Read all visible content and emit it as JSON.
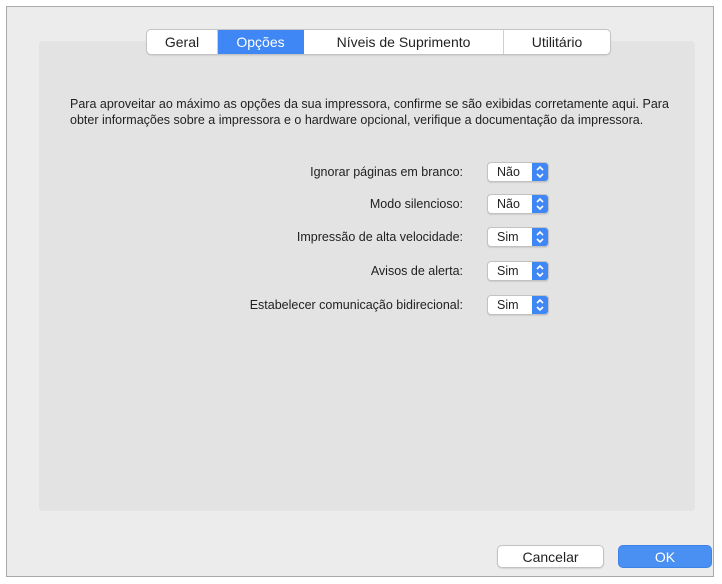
{
  "tabs": [
    {
      "label": "Geral",
      "selected": false
    },
    {
      "label": "Opções",
      "selected": true
    },
    {
      "label": "Níveis de Suprimento",
      "selected": false
    },
    {
      "label": "Utilitário",
      "selected": false
    }
  ],
  "description": "Para aproveitar ao máximo as opções da sua impressora, confirme se são exibidas corretamente aqui. Para obter informações sobre a impressora e o hardware opcional, verifique a documentação da impressora.",
  "options": [
    {
      "label": "Ignorar páginas em branco:",
      "value": "Não"
    },
    {
      "label": "Modo silencioso:",
      "value": "Não"
    },
    {
      "label": "Impressão de alta velocidade:",
      "value": "Sim"
    },
    {
      "label": "Avisos de alerta:",
      "value": "Sim"
    },
    {
      "label": "Estabelecer comunicação bidirecional:",
      "value": "Sim"
    }
  ],
  "buttons": {
    "cancel": "Cancelar",
    "ok": "OK"
  },
  "colors": {
    "accent": "#3f87f5",
    "panel": "#e3e3e3",
    "window": "#ececec"
  },
  "icons": {
    "popup_arrow": "up-down-chevron-icon"
  }
}
